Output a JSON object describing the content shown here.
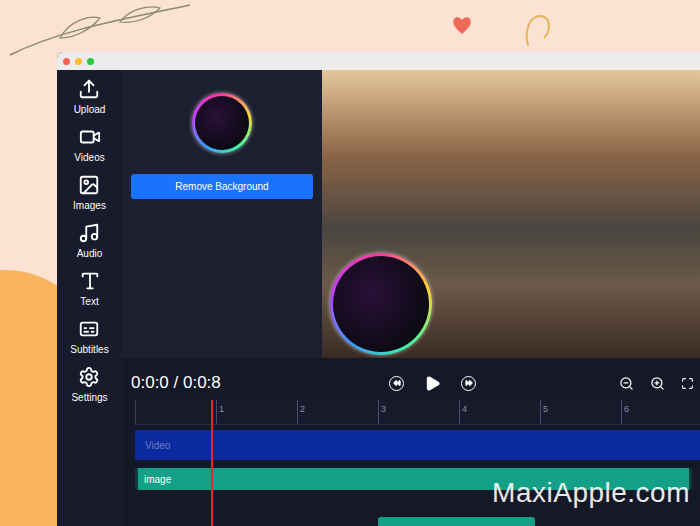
{
  "sidebar": {
    "items": [
      {
        "label": "Upload"
      },
      {
        "label": "Videos"
      },
      {
        "label": "Images"
      },
      {
        "label": "Audio"
      },
      {
        "label": "Text"
      },
      {
        "label": "Subtitles"
      },
      {
        "label": "Settings"
      }
    ]
  },
  "panel": {
    "button": "Remove Background"
  },
  "timeline": {
    "time": "0:0:0 / 0:0:8",
    "ruler_ticks": [
      "1",
      "2",
      "3",
      "4",
      "5",
      "6"
    ],
    "tracks": [
      {
        "label": "Video",
        "color": "#0b2aa0"
      },
      {
        "label": "image",
        "color": "#14a086"
      },
      {
        "color": "#14a086"
      }
    ]
  },
  "watermark": "MaxiApple.com"
}
